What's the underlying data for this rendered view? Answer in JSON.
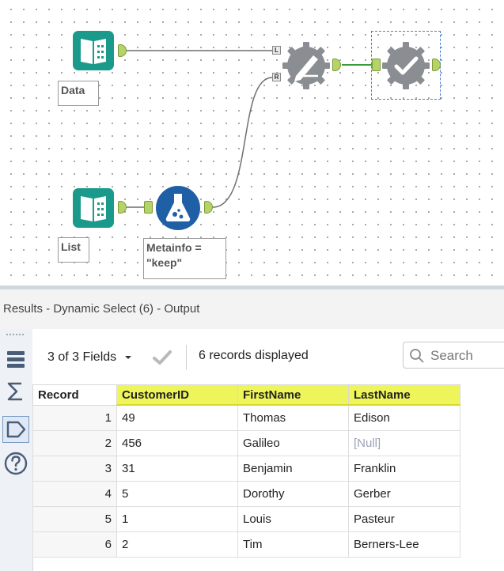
{
  "canvas": {
    "tools": {
      "data_input_label": "Data",
      "list_input_label": "List",
      "formula_label": "Metainfo =\n\"keep\"",
      "left_input_letter": "L",
      "right_input_letter": "R"
    }
  },
  "results": {
    "title": "Results - Dynamic Select (6) - Output",
    "fields_button": "3 of 3 Fields",
    "records_displayed": "6 records displayed",
    "search_placeholder": "Search",
    "columns": [
      "Record",
      "CustomerID",
      "FirstName",
      "LastName"
    ],
    "rows": [
      {
        "record": "1",
        "customer_id": "49",
        "first_name": "Thomas",
        "last_name": "Edison"
      },
      {
        "record": "2",
        "customer_id": "456",
        "first_name": "Galileo",
        "last_name": "[Null]"
      },
      {
        "record": "3",
        "customer_id": "31",
        "first_name": "Benjamin",
        "last_name": "Franklin"
      },
      {
        "record": "4",
        "customer_id": "5",
        "first_name": "Dorothy",
        "last_name": "Gerber"
      },
      {
        "record": "5",
        "customer_id": "1",
        "first_name": "Louis",
        "last_name": "Pasteur"
      },
      {
        "record": "6",
        "customer_id": "2",
        "first_name": "Tim",
        "last_name": "Berners-Lee"
      }
    ]
  },
  "colors": {
    "input_tool": "#1a9a8a",
    "formula_tool": "#1f5fa6",
    "gear_tool": "#8a8d92",
    "anchor": "#b6d36a",
    "header_highlight": "#eef55a",
    "connection": "#7a7a7a",
    "connection_active": "#3a9b3a"
  }
}
